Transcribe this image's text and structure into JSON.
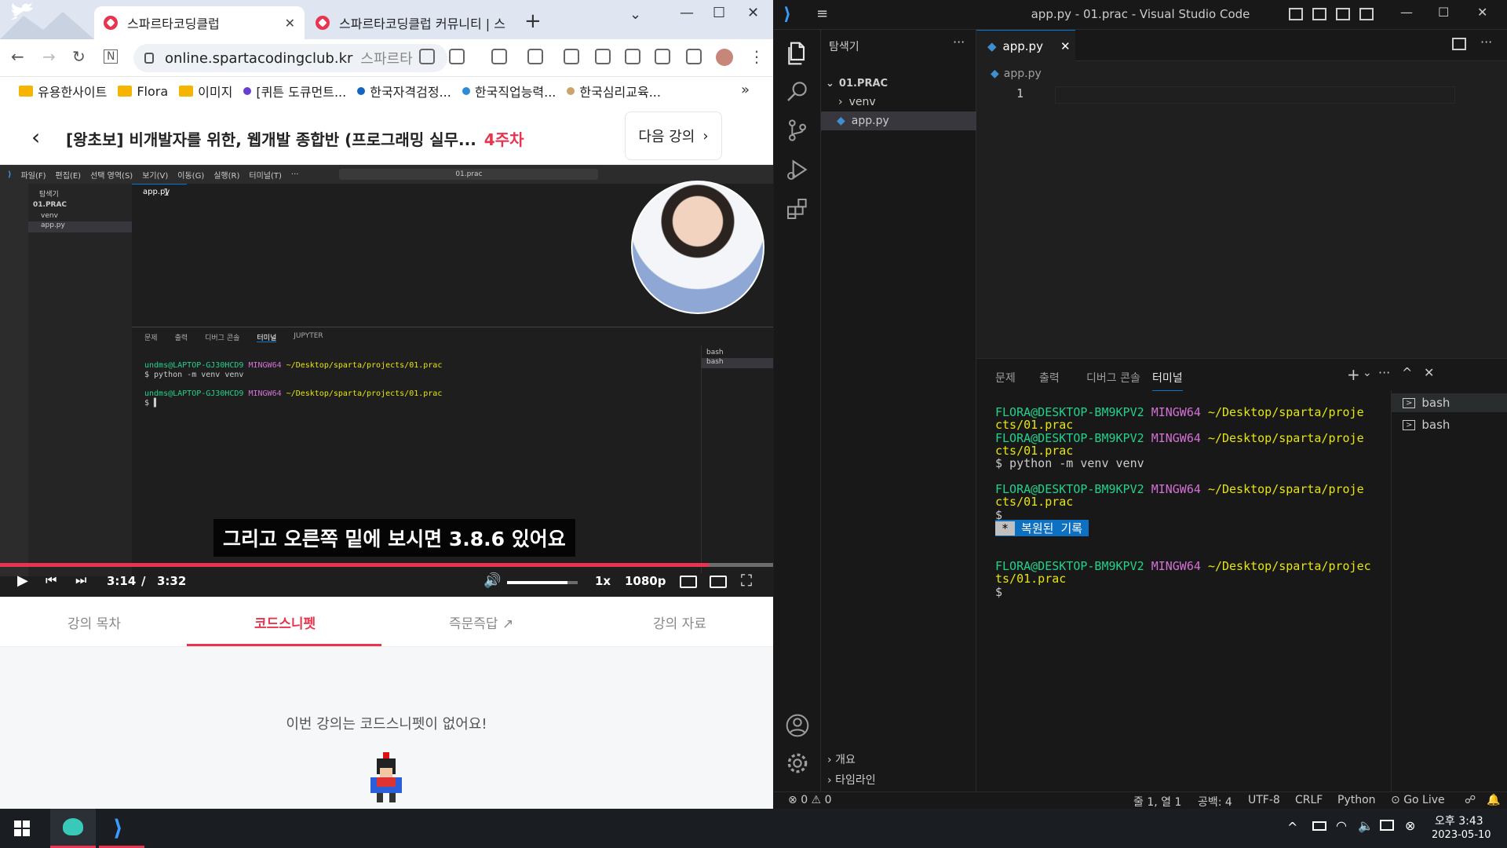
{
  "browser": {
    "tabs": [
      {
        "label": "스파르타코딩클럽"
      },
      {
        "label": "스파르타코딩클럽 커뮤니티 | 스"
      }
    ],
    "url": "online.spartacodingclub.kr",
    "url_suffix": "스파르타",
    "bookmarks": [
      {
        "label": "유용한사이트",
        "icon": "folder-icon"
      },
      {
        "label": "Flora",
        "icon": "folder-icon"
      },
      {
        "label": "이미지",
        "icon": "folder-icon"
      },
      {
        "label": "[퀴튼 도큐먼트...",
        "icon": "bookmark-dot",
        "color": "#6a3fd0"
      },
      {
        "label": "한국자격검정...",
        "icon": "bookmark-dot",
        "color": "#1565c0"
      },
      {
        "label": "한국직업능력...",
        "icon": "bookmark-dot",
        "color": "#2e8bd6"
      },
      {
        "label": "한국심리교육...",
        "icon": "bookmark-dot",
        "color": "#c9a56b"
      }
    ],
    "course_title": "[왕초보] 비개발자를 위한, 웹개발 종합반 (프로그래밍 실무...",
    "course_week": "4주차",
    "next_lecture": "다음 강의"
  },
  "video": {
    "inner_menu": [
      "파일(F)",
      "편집(E)",
      "선택 영역(S)",
      "보기(V)",
      "이동(G)",
      "실행(R)",
      "터미널(T)",
      "···"
    ],
    "inner_search": "01.prac",
    "inner_explorer": "탐색기",
    "inner_folder": "01.PRAC",
    "inner_venv": "venv",
    "inner_file": "app.py",
    "inner_panel_tabs": [
      "문제",
      "출력",
      "디버그 콘솔",
      "터미널",
      "JUPYTER"
    ],
    "inner_term_prompt": "undms@LAPTOP-GJ30HCD9",
    "inner_term_shell": "MINGW64",
    "inner_term_path": "~/Desktop/sparta/projects/01.prac",
    "inner_term_cmd": "$ python -m venv venv",
    "inner_term_dollar": "$",
    "inner_bash": "bash",
    "caption": "그리고 오른쪽 밑에 보시면 3.8.6 있어요",
    "current_time": "3:14",
    "separator": "/",
    "duration": "3:32",
    "progress": 0.917,
    "volume": 0.85,
    "speed": "1x",
    "quality": "1080p"
  },
  "content_tabs": [
    "강의 목차",
    "코드스니펫",
    "즉문즉답",
    "강의 자료"
  ],
  "active_content_tab": "코드스니펫",
  "no_snippet_text": "이번 강의는 코드스니펫이 없어요!",
  "vscode": {
    "title": "app.py - 01.prac - Visual Studio Code",
    "explorer_title": "탐색기",
    "explorer_more": "···",
    "folder": "01.PRAC",
    "venv": "venv",
    "file": "app.py",
    "tab": "app.py",
    "breadcrumb": "app.py",
    "line_number": "1",
    "panel_tabs": [
      "문제",
      "출력",
      "디버그 콘솔",
      "터미널"
    ],
    "terminals": [
      "bash",
      "bash"
    ],
    "term": {
      "user": "FLORA@DESKTOP-BM9KPV2",
      "shell": "MINGW64",
      "path_a": "~/Desktop/sparta/proje",
      "path_b": "cts/01.prac",
      "path_c": "~/Desktop/sparta/projec",
      "path_d": "ts/01.prac",
      "cmd": "$ python -m venv venv",
      "dollar": "$",
      "restored_star": "*",
      "restored": "복원된 기록"
    },
    "outline": "개요",
    "timeline": "타임라인",
    "status": {
      "errors": "0",
      "warnings": "0",
      "position": "줄 1, 열 1",
      "spaces": "공백: 4",
      "encoding": "UTF-8",
      "eol": "CRLF",
      "language": "Python",
      "golive": "Go Live"
    }
  },
  "taskbar": {
    "time": "오후 3:43",
    "date": "2023-05-10"
  },
  "colors": {
    "accent": "#e8344e",
    "vscode_blue": "#0078d4"
  }
}
